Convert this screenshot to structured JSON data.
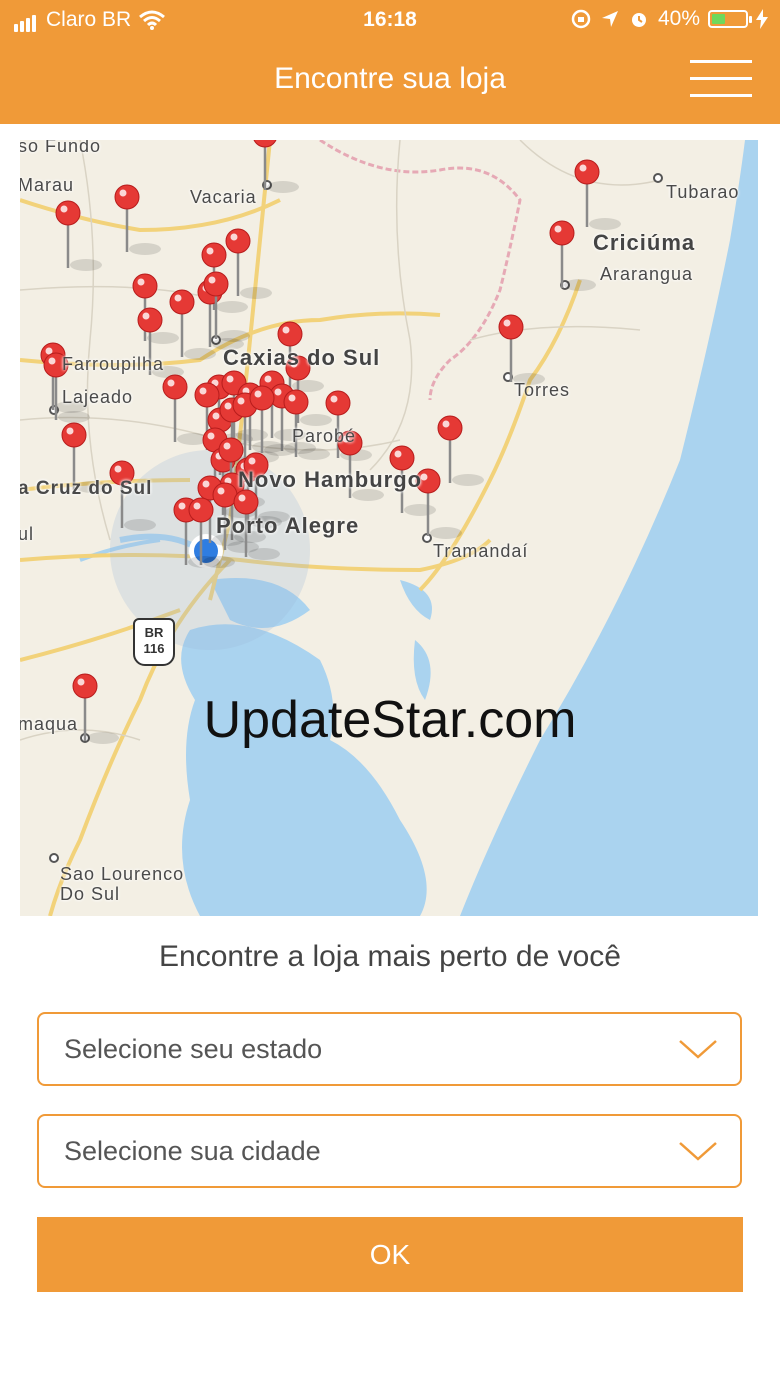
{
  "status_bar": {
    "carrier": "Claro BR",
    "time": "16:18",
    "battery": "40%",
    "battery_level": 0.4
  },
  "header": {
    "title": "Encontre sua loja",
    "menu_icon": "hamburger-menu-icon",
    "background_color": "#f09a38"
  },
  "map": {
    "labels": {
      "passo_fundo": "so Fundo",
      "marau": "Marau",
      "vacaria": "Vacaria",
      "tubarao": "Tubarao",
      "criciuma": "Criciúma",
      "ararangua": "Ararangua",
      "farroupilha": "Farroupilha",
      "caxias": "Caxias do Sul",
      "lajeado": "Lajeado",
      "torres": "Torres",
      "parobe": "Parobé",
      "novo_hamburgo": "Novo Hamburgo",
      "santa_cruz": "a Cruz do Sul",
      "porto_alegre": "Porto Alegre",
      "tramandai": "Tramandaí",
      "ul": "ul",
      "camaqua": "maqua",
      "sao_lourenco": "Sao Lourenco",
      "do_sul": "Do Sul",
      "highway_prefix": "BR",
      "highway_number": "116"
    },
    "pin_color": "#e53935",
    "water_color": "#aad3ef",
    "user_location_color": "#2f7de1"
  },
  "watermark": "UpdateStar.com",
  "form": {
    "subtitle": "Encontre a loja mais perto de você",
    "state_placeholder": "Selecione seu estado",
    "city_placeholder": "Selecione sua cidade",
    "ok_label": "OK",
    "accent_color": "#f09a38"
  }
}
